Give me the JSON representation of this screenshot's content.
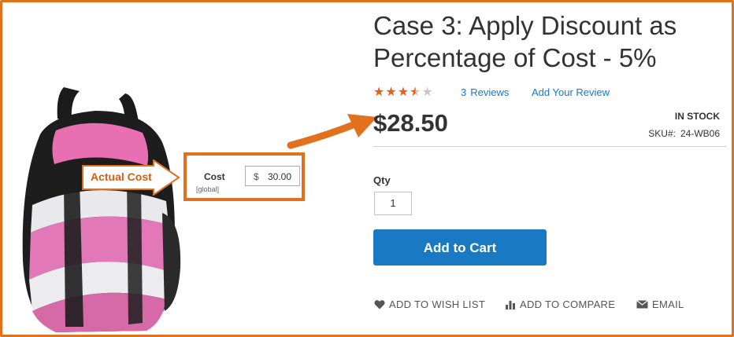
{
  "product": {
    "title_line1": "Case 3: Apply Discount as",
    "title_line2": "Percentage of Cost - 5%",
    "rating": 3.5,
    "rating_max": 5,
    "reviews_count": "3",
    "reviews_label": "Reviews",
    "add_review_label": "Add Your Review",
    "price": "$28.50",
    "stock_status": "IN STOCK",
    "sku_label": "SKU#:",
    "sku": "24-WB06",
    "qty_label": "Qty",
    "qty_value": "1",
    "add_to_cart_label": "Add to Cart",
    "actions": {
      "wishlist": "ADD TO WISH LIST",
      "compare": "ADD TO COMPARE",
      "email": "EMAIL"
    }
  },
  "annotation": {
    "callout_label": "Actual Cost",
    "cost_label": "Cost",
    "cost_scope": "[global]",
    "cost_currency": "$",
    "cost_value": "30.00"
  },
  "colors": {
    "accent_orange": "#e2711d",
    "button_blue": "#1979c3",
    "star_orange": "#e2621a",
    "link_blue": "#1979c3"
  },
  "icons": {
    "wishlist": "heart-icon",
    "compare": "bar-chart-icon",
    "email": "envelope-icon"
  }
}
